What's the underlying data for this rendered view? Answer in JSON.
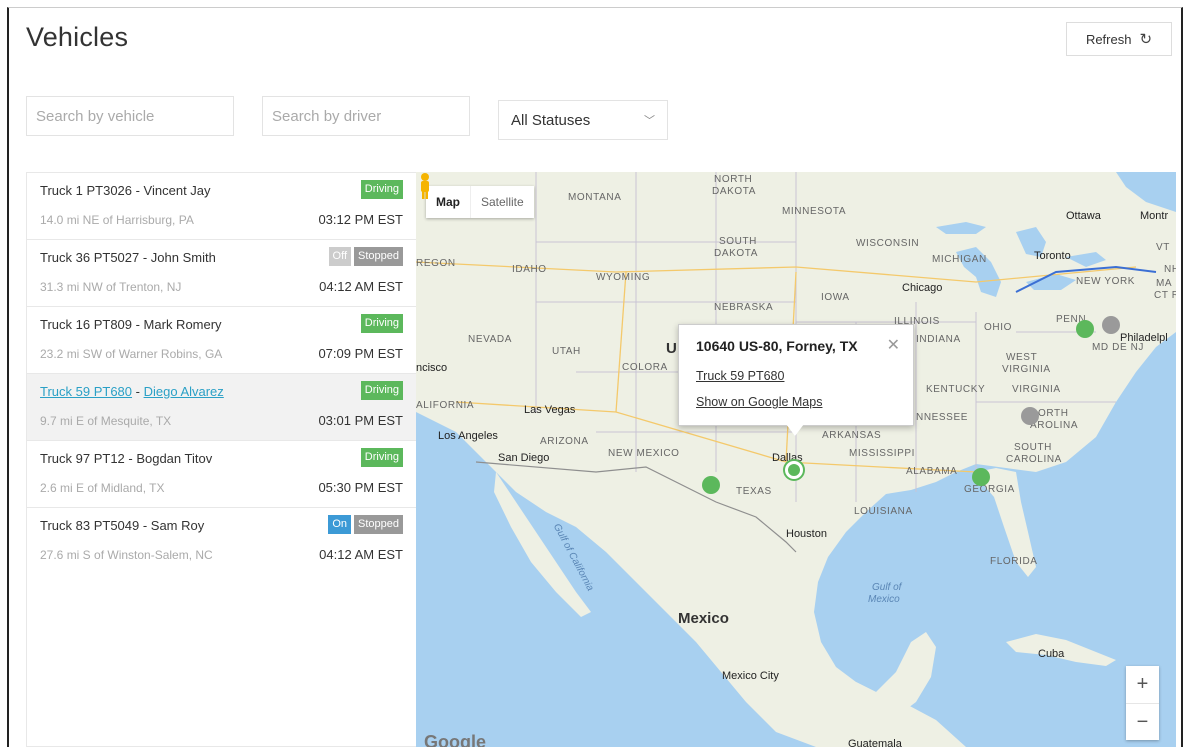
{
  "page": {
    "title": "Vehicles"
  },
  "toolbar": {
    "refresh_label": "Refresh",
    "refresh_icon": "refresh-icon"
  },
  "filters": {
    "vehicle_placeholder": "Search by vehicle",
    "driver_placeholder": "Search by driver",
    "status_selected": "All Statuses"
  },
  "vehicles": [
    {
      "name": "Truck 1 PT3026 - Vincent Jay",
      "location": "14.0 mi NE of Harrisburg, PA",
      "time": "03:12 PM EST",
      "badges": [
        "Driving"
      ]
    },
    {
      "name": "Truck 36 PT5027 - John Smith",
      "location": "31.3 mi NW of Trenton, NJ",
      "time": "04:12 AM EST",
      "badges": [
        "Off",
        "Stopped"
      ]
    },
    {
      "name": "Truck 16 PT809 - Mark Romery",
      "location": "23.2 mi SW of Warner Robins, GA",
      "time": "07:09 PM EST",
      "badges": [
        "Driving"
      ]
    },
    {
      "name": "Truck 59 PT680",
      "driver": "Diego Alvarez",
      "sep": " - ",
      "location": "9.7 mi E of Mesquite, TX",
      "time": "03:01 PM EST",
      "badges": [
        "Driving"
      ],
      "selected": true
    },
    {
      "name": "Truck 97 PT12 - Bogdan Titov",
      "location": "2.6 mi E of Midland, TX",
      "time": "05:30 PM EST",
      "badges": [
        "Driving"
      ]
    },
    {
      "name": "Truck 83 PT5049 - Sam Roy",
      "location": "27.6 mi S of Winston-Salem, NC",
      "time": "04:12 AM EST",
      "badges": [
        "On",
        "Stopped"
      ]
    }
  ],
  "map": {
    "type_map": "Map",
    "type_satellite": "Satellite",
    "popup": {
      "address": "10640 US-80, Forney, TX",
      "vehicle_link": "Truck 59 PT680",
      "maps_link": "Show on Google Maps"
    },
    "zoom_in": "+",
    "zoom_out": "−",
    "labels": {
      "north_dakota_1": "NORTH",
      "north_dakota_2": "DAKOTA",
      "montana": "MONTANA",
      "minnesota": "MINNESOTA",
      "south_dakota_1": "SOUTH",
      "south_dakota_2": "DAKOTA",
      "wisconsin": "WISCONSIN",
      "michigan": "MICHIGAN",
      "oregon": "REGON",
      "idaho": "IDAHO",
      "wyoming": "WYOMING",
      "iowa": "IOWA",
      "nebraska": "NEBRASKA",
      "illinois": "ILLINOIS",
      "ohio": "OHIO",
      "nevada": "NEVADA",
      "utah": "UTAH",
      "colorado": "COLORA",
      "indiana": "INDIANA",
      "west_virginia_1": "WEST",
      "west_virginia_2": "VIRGINIA",
      "kentucky": "KENTUCKY",
      "virginia": "VIRGINIA",
      "california": "ALIFORNIA",
      "tennessee": "NNESSEE",
      "north_carolina_1": "ORTH",
      "north_carolina_2": "AROLINA",
      "arizona": "ARIZONA",
      "new_mexico": "NEW MEXICO",
      "arkansas": "ARKANSAS",
      "mississippi": "MISSISSIPPI",
      "alabama": "ALABAMA",
      "south_carolina_1": "SOUTH",
      "south_carolina_2": "CAROLINA",
      "texas": "TEXAS",
      "georgia": "GEORGIA",
      "louisiana": "LOUISIANA",
      "florida": "FLORIDA",
      "vermont": "VT",
      "new_hampshire": "NH",
      "new_york": "NEW YORK",
      "massachusetts": "MA",
      "connecticut": "CT RI",
      "md_de_nj": "MD DE NJ",
      "pennsylvania": "PENN",
      "ottawa": "Ottawa",
      "montreal": "Montr",
      "toronto": "Toronto",
      "chicago": "Chicago",
      "philadelphia": "Philadelpl",
      "las_vegas": "Las Vegas",
      "los_angeles": "Los Angeles",
      "san_diego": "San Diego",
      "sf": "ncisco",
      "dallas": "Dallas",
      "houston": "Houston",
      "mexico_city": "Mexico City",
      "cuba": "Cuba",
      "guatemala": "Guatemala",
      "gulf_mexico_1": "Gulf of",
      "gulf_mexico_2": "Mexico",
      "gulf_california": "Gulf of California",
      "mexico": "Mexico",
      "u": "U",
      "google": "Google"
    }
  }
}
